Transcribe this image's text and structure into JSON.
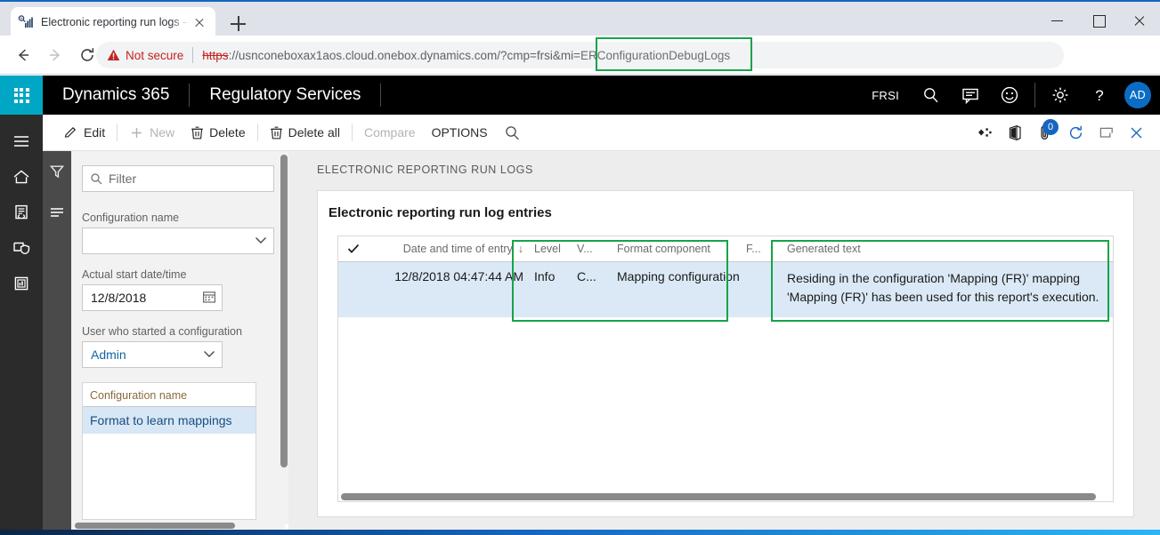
{
  "browser": {
    "tab": {
      "title": "Electronic reporting run logs -- R",
      "favicon_icon": "report-chart-icon",
      "close_icon": "close-icon"
    },
    "new_tab_icon": "plus-icon",
    "window_controls": {
      "minimize": "minimize-icon",
      "maximize": "maximize-icon",
      "close": "close-icon"
    },
    "nav": {
      "back_icon": "arrow-left-icon",
      "forward_icon": "arrow-right-icon",
      "reload_icon": "reload-icon"
    },
    "omnibox": {
      "warning_icon": "warning-triangle-icon",
      "security_label": "Not secure",
      "url_scheme": "https",
      "url_rest": "://usnconeboxax1aos.cloud.onebox.dynamics.com/?cmp=frsi&mi=",
      "url_highlight": "ERConfigurationDebugLogs"
    },
    "actions": {
      "bookmark_icon": "star-icon",
      "profile_icon": "account-circle-icon",
      "update_icon": "update-arrow-icon"
    }
  },
  "d365_header": {
    "waffle_icon": "app-launcher-icon",
    "brand": "Dynamics 365",
    "module": "Regulatory Services",
    "company": "FRSI",
    "icons": [
      "search-icon",
      "message-icon",
      "smiley-icon",
      "gear-icon",
      "help-icon"
    ],
    "avatar_initials": "AD"
  },
  "nav_rail": {
    "items": [
      {
        "icon": "hamburger-menu-icon",
        "name": "expand-navigation"
      },
      {
        "icon": "home-icon",
        "name": "home"
      },
      {
        "icon": "recent-document-icon",
        "name": "recent"
      },
      {
        "icon": "favorites-shield-icon",
        "name": "favorites"
      },
      {
        "icon": "workspace-icon",
        "name": "workspaces"
      }
    ]
  },
  "action_pane": {
    "buttons": [
      {
        "label": "Edit",
        "icon": "pencil-icon",
        "disabled": false
      },
      {
        "label": "New",
        "icon": "plus-icon",
        "disabled": true
      },
      {
        "label": "Delete",
        "icon": "trash-icon",
        "disabled": false
      },
      {
        "label": "Delete all",
        "icon": "trash-icon",
        "disabled": false
      },
      {
        "label": "Compare",
        "icon": "",
        "disabled": true
      },
      {
        "label": "OPTIONS",
        "icon": "",
        "disabled": false
      }
    ],
    "search_icon": "search-icon",
    "right_icons": [
      {
        "icon": "personalize-icon",
        "name": "personalize"
      },
      {
        "icon": "office-icon",
        "name": "open-in-office"
      },
      {
        "icon": "attachment-icon",
        "name": "attachments",
        "badge": "0"
      },
      {
        "icon": "refresh-icon",
        "name": "refresh"
      },
      {
        "icon": "popout-icon",
        "name": "open-in-new-window"
      },
      {
        "icon": "close-icon",
        "name": "close-page"
      }
    ]
  },
  "filter_pane": {
    "rail_icons": [
      "filter-icon",
      "list-icon"
    ],
    "search": {
      "placeholder": "Filter",
      "icon": "search-icon"
    },
    "fields": [
      {
        "label": "Configuration name",
        "value": "",
        "type": "dropdown"
      },
      {
        "label": "Actual start date/time",
        "value": "12/8/2018",
        "type": "date"
      },
      {
        "label": "User who started a configuration",
        "value": "Admin",
        "type": "dropdown"
      }
    ],
    "list": {
      "header": "Configuration name",
      "rows": [
        "Format to learn mappings"
      ]
    }
  },
  "main": {
    "breadcrumb": "ELECTRONIC REPORTING RUN LOGS",
    "card_title": "Electronic reporting run log entries",
    "grid": {
      "columns": [
        {
          "key": "check",
          "label": "",
          "icon": "checkmark-icon"
        },
        {
          "key": "date",
          "label": "Date and time of entry",
          "sort": "↓"
        },
        {
          "key": "level",
          "label": "Level"
        },
        {
          "key": "v",
          "label": "V..."
        },
        {
          "key": "format_component",
          "label": "Format component"
        },
        {
          "key": "f",
          "label": "F..."
        },
        {
          "key": "generated_text",
          "label": "Generated text"
        }
      ],
      "rows": [
        {
          "date": "12/8/2018 04:47:44 AM",
          "level": "Info",
          "v": "C...",
          "format_component": "Mapping configuration",
          "f": "",
          "generated_text": "Residing in the configuration 'Mapping (FR)' mapping 'Mapping (FR)' has been used for this report's execution."
        }
      ]
    }
  },
  "annotations": {
    "highlight_color": "#16a34a",
    "boxes": [
      "url-parameter",
      "level-format-columns",
      "generated-text-column"
    ]
  }
}
